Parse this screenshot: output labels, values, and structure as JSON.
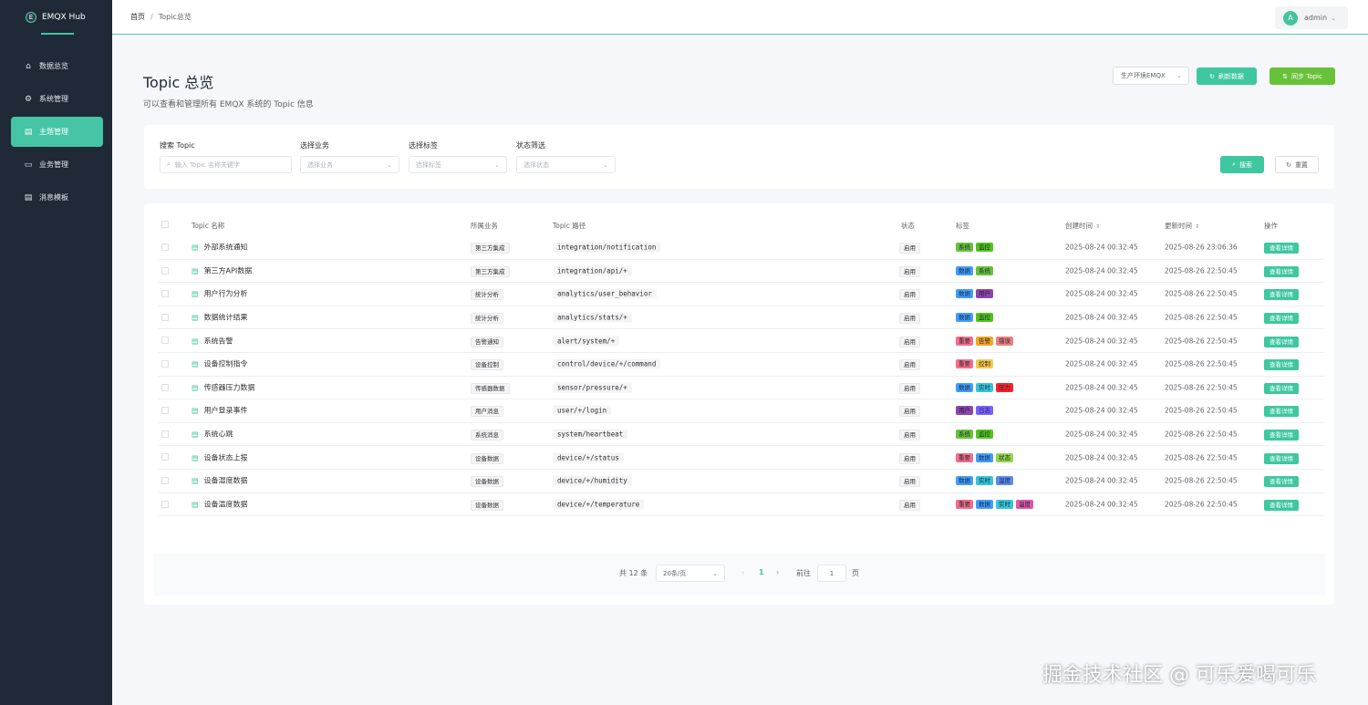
{
  "app": {
    "logo_letter": "E",
    "name": "EMQX Hub"
  },
  "sidebar": {
    "items": [
      {
        "label": "数据总览",
        "icon": "home-icon",
        "glyph": "⌂",
        "active": false
      },
      {
        "label": "系统管理",
        "icon": "gear-icon",
        "glyph": "⚙",
        "active": false
      },
      {
        "label": "主题管理",
        "icon": "document-icon",
        "glyph": "▤",
        "active": true
      },
      {
        "label": "业务管理",
        "icon": "folder-icon",
        "glyph": "▭",
        "active": false
      },
      {
        "label": "消息模板",
        "icon": "template-icon",
        "glyph": "▤",
        "active": false
      }
    ]
  },
  "header": {
    "breadcrumb": {
      "home": "首页",
      "sep": "/",
      "current": "Topic总览"
    },
    "user": {
      "avatar": "A",
      "name": "admin"
    }
  },
  "page": {
    "title": "Topic 总览",
    "subtitle": "可以查看和管理所有 EMQX 系统的 Topic 信息",
    "env_select": "生产环境EMQX",
    "refresh_label": "刷新数据",
    "sync_label": "同步 Topic"
  },
  "filters": {
    "search_label": "搜索 Topic",
    "search_placeholder": "输入 Topic 名称关键字",
    "business_label": "选择业务",
    "business_placeholder": "选择业务",
    "tag_label": "选择标签",
    "tag_placeholder": "选择标签",
    "status_label": "状态筛选",
    "status_placeholder": "选择状态",
    "search_button": "搜索",
    "reset_button": "重置"
  },
  "table": {
    "columns": [
      "Topic 名称",
      "所属业务",
      "Topic 路径",
      "状态",
      "标签",
      "创建时间",
      "更新时间",
      "操作"
    ],
    "detail_label": "查看详情",
    "rows": [
      {
        "name": "外部系统通知",
        "biz": "第三方集成",
        "path": "integration/notification",
        "status": "启用",
        "tags": [
          {
            "t": "系统",
            "c": "#67c23a"
          },
          {
            "t": "监控",
            "c": "#52c41a"
          }
        ],
        "created": "2025-08-24 00:32:45",
        "updated": "2025-08-26 23:06:36"
      },
      {
        "name": "第三方API数据",
        "biz": "第三方集成",
        "path": "integration/api/+",
        "status": "启用",
        "tags": [
          {
            "t": "数据",
            "c": "#409eff"
          },
          {
            "t": "系统",
            "c": "#67c23a"
          }
        ],
        "created": "2025-08-24 00:32:45",
        "updated": "2025-08-26 22:50:45"
      },
      {
        "name": "用户行为分析",
        "biz": "统计分析",
        "path": "analytics/user_behavior",
        "status": "启用",
        "tags": [
          {
            "t": "数据",
            "c": "#409eff"
          },
          {
            "t": "用户",
            "c": "#8e44ad"
          }
        ],
        "created": "2025-08-24 00:32:45",
        "updated": "2025-08-26 22:50:45"
      },
      {
        "name": "数据统计结果",
        "biz": "统计分析",
        "path": "analytics/stats/+",
        "status": "启用",
        "tags": [
          {
            "t": "数据",
            "c": "#409eff"
          },
          {
            "t": "监控",
            "c": "#52c41a"
          }
        ],
        "created": "2025-08-24 00:32:45",
        "updated": "2025-08-26 22:50:45"
      },
      {
        "name": "系统告警",
        "biz": "告警通知",
        "path": "alert/system/+",
        "status": "启用",
        "tags": [
          {
            "t": "重要",
            "c": "#f56c8a"
          },
          {
            "t": "告警",
            "c": "#f5a623"
          },
          {
            "t": "错误",
            "c": "#f08080"
          }
        ],
        "created": "2025-08-24 00:32:45",
        "updated": "2025-08-26 22:50:45"
      },
      {
        "name": "设备控制指令",
        "biz": "设备控制",
        "path": "control/device/+/command",
        "status": "启用",
        "tags": [
          {
            "t": "重要",
            "c": "#f56c8a"
          },
          {
            "t": "控制",
            "c": "#f7c948"
          }
        ],
        "created": "2025-08-24 00:32:45",
        "updated": "2025-08-26 22:50:45"
      },
      {
        "name": "传感器压力数据",
        "biz": "传感器数据",
        "path": "sensor/pressure/+",
        "status": "启用",
        "tags": [
          {
            "t": "数据",
            "c": "#409eff"
          },
          {
            "t": "实时",
            "c": "#36c5d8"
          },
          {
            "t": "压力",
            "c": "#f5222d"
          }
        ],
        "created": "2025-08-24 00:32:45",
        "updated": "2025-08-26 22:50:45"
      },
      {
        "name": "用户登录事件",
        "biz": "用户消息",
        "path": "user/+/login",
        "status": "启用",
        "tags": [
          {
            "t": "用户",
            "c": "#8e44ad"
          },
          {
            "t": "日志",
            "c": "#7b61ff"
          }
        ],
        "created": "2025-08-24 00:32:45",
        "updated": "2025-08-26 22:50:45"
      },
      {
        "name": "系统心跳",
        "biz": "系统消息",
        "path": "system/heartbeat",
        "status": "启用",
        "tags": [
          {
            "t": "系统",
            "c": "#67c23a"
          },
          {
            "t": "监控",
            "c": "#52c41a"
          }
        ],
        "created": "2025-08-24 00:32:45",
        "updated": "2025-08-26 22:50:45"
      },
      {
        "name": "设备状态上报",
        "biz": "设备数据",
        "path": "device/+/status",
        "status": "启用",
        "tags": [
          {
            "t": "重要",
            "c": "#f56c8a"
          },
          {
            "t": "数据",
            "c": "#409eff"
          },
          {
            "t": "状态",
            "c": "#95d44b"
          }
        ],
        "created": "2025-08-24 00:32:45",
        "updated": "2025-08-26 22:50:45"
      },
      {
        "name": "设备湿度数据",
        "biz": "设备数据",
        "path": "device/+/humidity",
        "status": "启用",
        "tags": [
          {
            "t": "数据",
            "c": "#409eff"
          },
          {
            "t": "实时",
            "c": "#36c5d8"
          },
          {
            "t": "湿度",
            "c": "#5b8def"
          }
        ],
        "created": "2025-08-24 00:32:45",
        "updated": "2025-08-26 22:50:45"
      },
      {
        "name": "设备温度数据",
        "biz": "设备数据",
        "path": "device/+/temperature",
        "status": "启用",
        "tags": [
          {
            "t": "重要",
            "c": "#f56c8a"
          },
          {
            "t": "数据",
            "c": "#409eff"
          },
          {
            "t": "实时",
            "c": "#36c5d8"
          },
          {
            "t": "温度",
            "c": "#e056a8"
          }
        ],
        "created": "2025-08-24 00:32:45",
        "updated": "2025-08-26 22:50:45"
      }
    ]
  },
  "pagination": {
    "total": "共 12 条",
    "page_size": "20条/页",
    "prev": "‹",
    "current": "1",
    "next": "›",
    "goto": "前往",
    "goto_value": "1",
    "unit": "页"
  },
  "watermark": "掘金技术社区 @ 可乐爱喝可乐"
}
